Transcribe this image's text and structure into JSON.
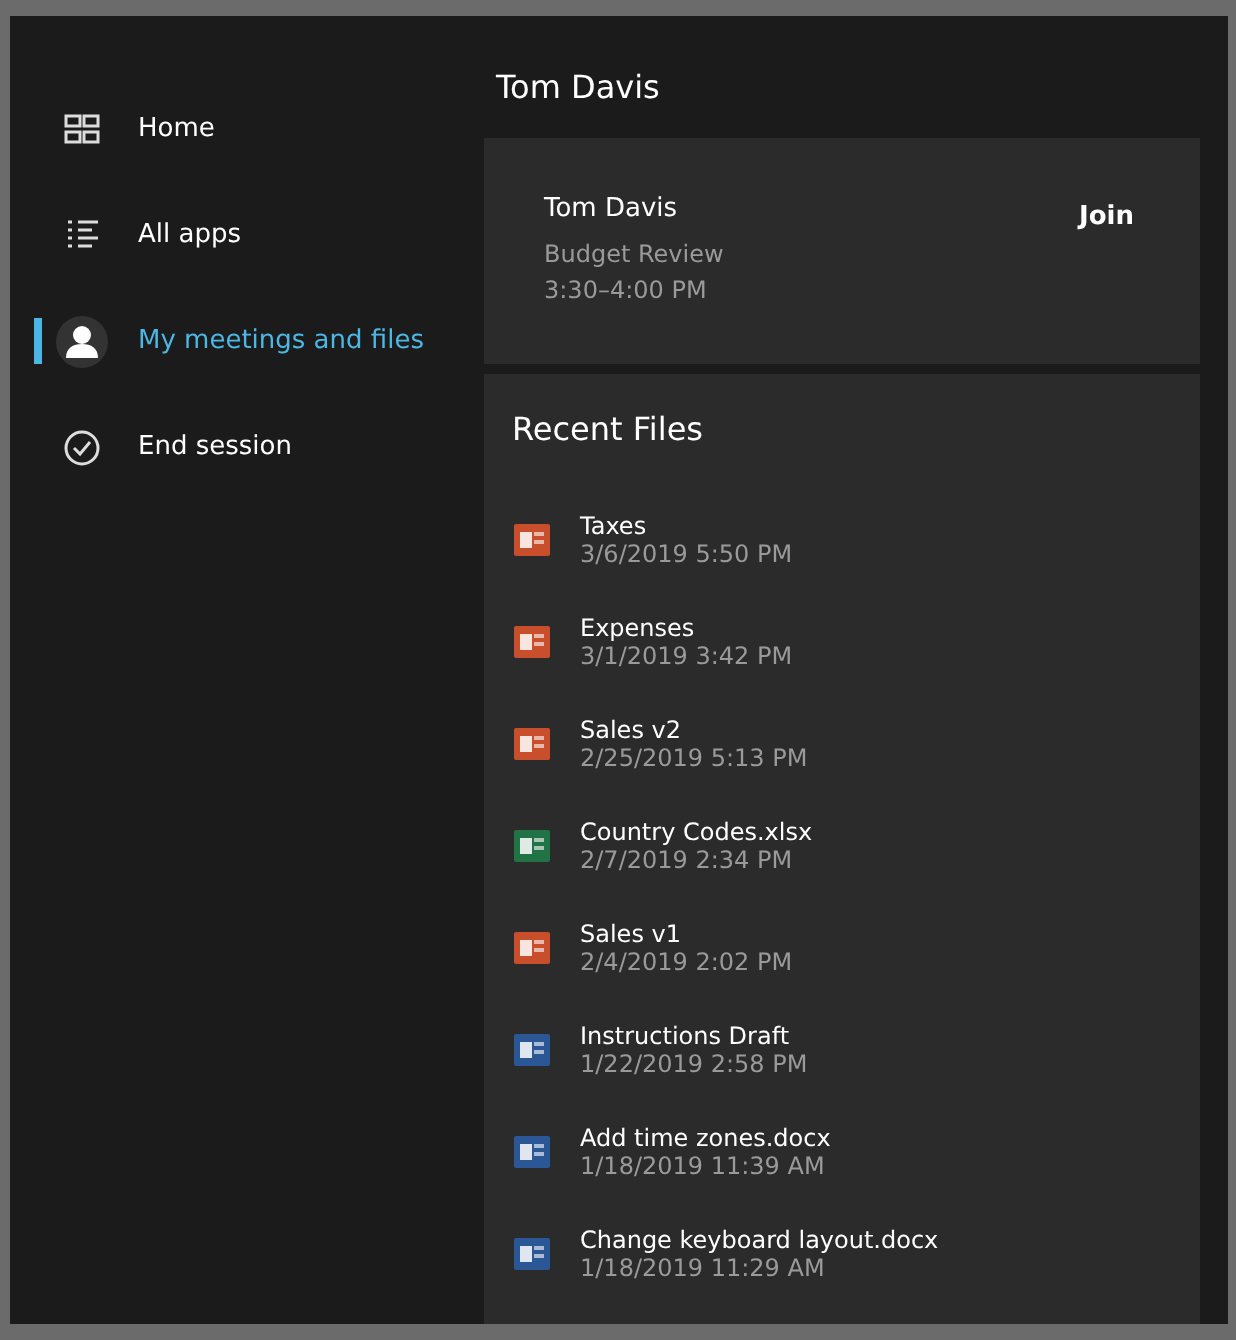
{
  "sidebar": {
    "items": [
      {
        "label": "Home",
        "kind": "home",
        "selected": false
      },
      {
        "label": "All apps",
        "kind": "apps",
        "selected": false
      },
      {
        "label": "My meetings and files",
        "kind": "person",
        "selected": true
      },
      {
        "label": "End session",
        "kind": "check",
        "selected": false
      }
    ]
  },
  "header": {
    "title": "Tom Davis"
  },
  "meeting": {
    "organizer": "Tom Davis",
    "subject": "Budget Review",
    "time": "3:30–4:00 PM",
    "action": "Join"
  },
  "recent_files": {
    "title": "Recent Files",
    "files": [
      {
        "name": "Taxes",
        "date": "3/6/2019 5:50 PM",
        "kind": "powerpoint"
      },
      {
        "name": "Expenses",
        "date": "3/1/2019 3:42 PM",
        "kind": "powerpoint"
      },
      {
        "name": "Sales v2",
        "date": "2/25/2019 5:13 PM",
        "kind": "powerpoint"
      },
      {
        "name": "Country Codes.xlsx",
        "date": "2/7/2019 2:34 PM",
        "kind": "excel"
      },
      {
        "name": "Sales v1",
        "date": "2/4/2019 2:02 PM",
        "kind": "powerpoint"
      },
      {
        "name": "Instructions Draft",
        "date": "1/22/2019 2:58 PM",
        "kind": "word"
      },
      {
        "name": "Add time zones.docx",
        "date": "1/18/2019 11:39 AM",
        "kind": "word"
      },
      {
        "name": "Change keyboard layout.docx",
        "date": "1/18/2019 11:29 AM",
        "kind": "word"
      }
    ]
  }
}
